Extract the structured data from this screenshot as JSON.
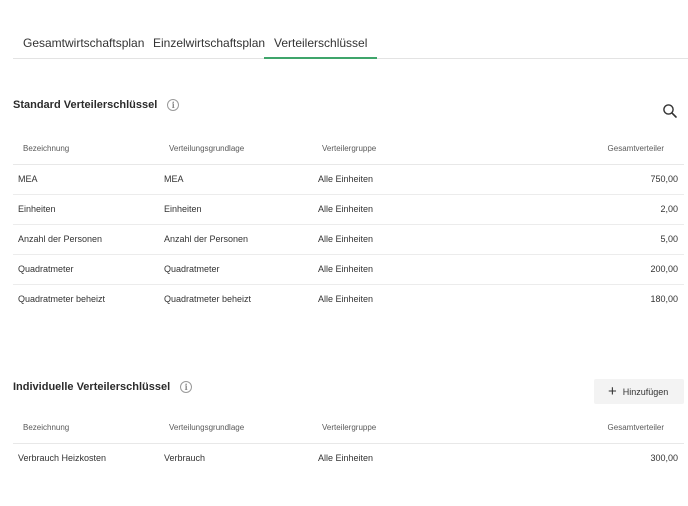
{
  "tabs": [
    {
      "label": "Gesamtwirtschaftsplan",
      "active": false
    },
    {
      "label": "Einzelwirtschaftsplan",
      "active": false
    },
    {
      "label": "Verteilerschlüssel",
      "active": true
    }
  ],
  "colors": {
    "accent": "#3fa56b"
  },
  "standard": {
    "title": "Standard Verteilerschlüssel",
    "info_icon": "info-icon",
    "search_icon": "search-icon",
    "columns": [
      "Bezeichnung",
      "Verteilungsgrundlage",
      "Verteilergruppe",
      "Gesamtverteiler"
    ],
    "rows": [
      {
        "bezeichnung": "MEA",
        "grundlage": "MEA",
        "gruppe": "Alle Einheiten",
        "gesamt": "750,00"
      },
      {
        "bezeichnung": "Einheiten",
        "grundlage": "Einheiten",
        "gruppe": "Alle Einheiten",
        "gesamt": "2,00"
      },
      {
        "bezeichnung": "Anzahl der Personen",
        "grundlage": "Anzahl der Personen",
        "gruppe": "Alle Einheiten",
        "gesamt": "5,00"
      },
      {
        "bezeichnung": "Quadratmeter",
        "grundlage": "Quadratmeter",
        "gruppe": "Alle Einheiten",
        "gesamt": "200,00"
      },
      {
        "bezeichnung": "Quadratmeter beheizt",
        "grundlage": "Quadratmeter beheizt",
        "gruppe": "Alle Einheiten",
        "gesamt": "180,00"
      }
    ]
  },
  "individual": {
    "title": "Individuelle Verteilerschlüssel",
    "info_icon": "info-icon",
    "add_label": "Hinzufügen",
    "add_icon": "plus-icon",
    "columns": [
      "Bezeichnung",
      "Verteilungsgrundlage",
      "Verteilergruppe",
      "Gesamtverteiler"
    ],
    "rows": [
      {
        "bezeichnung": "Verbrauch Heizkosten",
        "grundlage": "Verbrauch",
        "gruppe": "Alle Einheiten",
        "gesamt": "300,00"
      }
    ]
  }
}
